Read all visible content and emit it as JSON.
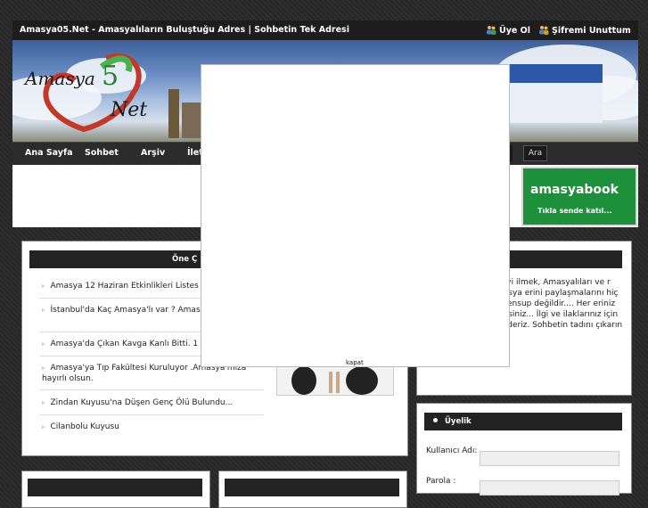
{
  "header": {
    "site_title": "Amasya05.Net - Amasyalıların Buluştuğu Adres | Sohbetin Tek Adresi",
    "register": "Üye Ol",
    "forgot_password": "Şifremi Unuttum"
  },
  "nav": {
    "items": [
      "Ana Sayfa",
      "Sohbet",
      "Arşiv",
      "İlet"
    ],
    "search": "Ara"
  },
  "ad": {
    "title": "amasyabook",
    "subtitle": "Tıkla sende katıl..."
  },
  "featured": {
    "title": "Öne Ç",
    "news": [
      "Amasya 12 Haziran Etkinlikleri Listes",
      "İstanbul'da Kaç Amasya'lı var ? Amas Sırada ?",
      "Amasya'da Çıkan Kavga Kanlı Bitti. 1",
      "Amasya'ya Tıp Fakültesi Kuruluyor .Amasya'mıza hayırlı olsun.",
      "Zindan Kuyusu'na Düşen Genç Ölü Bulundu...",
      "Cilanbolu Kuyusu"
    ]
  },
  "about": {
    "text": "acı Amasyayı daha iyi ilmek, Amasyalıları ve r araya getirerek Amasya erini paylaşmalarını hiç bir kurum kuruluş mensup değildir.... Her eriniz için iletişim ulaşabiirsiniz... İlgi ve ilaklarınız için şimdiden teşekkür ederiz. Sohbetin tadını çıkarın iyi sohbetler..."
  },
  "membership": {
    "title": "Üyelik",
    "username_label": "Kullanıcı Adı:",
    "password_label": "Parola :"
  },
  "popup": {
    "close": "kapat"
  },
  "colors": {
    "header_bg": "#1d1d1d",
    "panel_header_bg": "#232323",
    "ad_green": "#1e8f3a"
  }
}
